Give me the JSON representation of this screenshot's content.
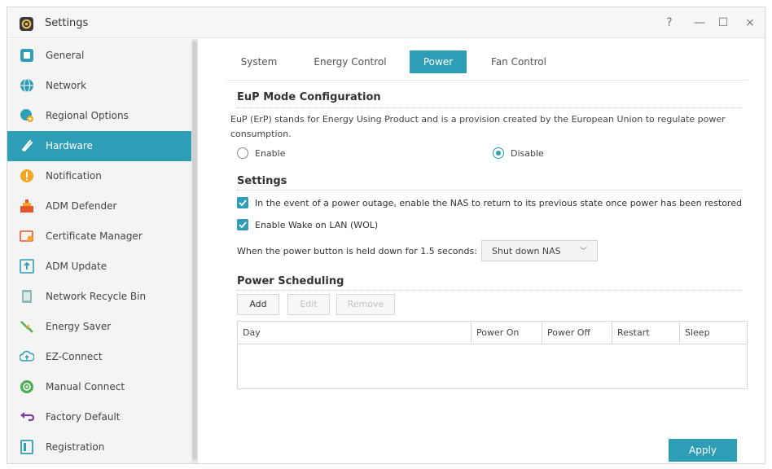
{
  "window": {
    "title": "Settings",
    "help_glyph": "?",
    "minimize_glyph": "—",
    "maximize_glyph": "☐",
    "close_glyph": "×"
  },
  "sidebar": {
    "items": [
      {
        "label": "General",
        "icon": "general-icon",
        "color": "#2e9db6"
      },
      {
        "label": "Network",
        "icon": "globe-icon",
        "color": "#2e9db6"
      },
      {
        "label": "Regional Options",
        "icon": "regional-icon",
        "color": "#2e9db6"
      },
      {
        "label": "Hardware",
        "icon": "hardware-icon",
        "color": "#ffffff",
        "active": true
      },
      {
        "label": "Notification",
        "icon": "notification-icon",
        "color": "#f5a623"
      },
      {
        "label": "ADM Defender",
        "icon": "defender-icon",
        "color": "#e8542c"
      },
      {
        "label": "Certificate Manager",
        "icon": "certificate-icon",
        "color": "#e8542c"
      },
      {
        "label": "ADM Update",
        "icon": "update-icon",
        "color": "#2e9db6"
      },
      {
        "label": "Network Recycle Bin",
        "icon": "recycle-bin-icon",
        "color": "#7aa"
      },
      {
        "label": "Energy Saver",
        "icon": "energy-saver-icon",
        "color": "#4caf50"
      },
      {
        "label": "EZ-Connect",
        "icon": "cloud-icon",
        "color": "#2e9db6"
      },
      {
        "label": "Manual Connect",
        "icon": "manual-connect-icon",
        "color": "#4caf50"
      },
      {
        "label": "Factory Default",
        "icon": "undo-icon",
        "color": "#7b3fa0"
      },
      {
        "label": "Registration",
        "icon": "registration-icon",
        "color": "#2e9db6"
      }
    ]
  },
  "tabs": [
    {
      "label": "System"
    },
    {
      "label": "Energy Control"
    },
    {
      "label": "Power",
      "active": true
    },
    {
      "label": "Fan Control"
    }
  ],
  "eup": {
    "title": "EuP Mode Configuration",
    "description": "EuP (ErP) stands for Energy Using Product and is a provision created by the European Union to regulate power consumption.",
    "enable_label": "Enable",
    "disable_label": "Disable",
    "selected": "Disable"
  },
  "settings": {
    "title": "Settings",
    "restore_label": "In the event of a power outage, enable the NAS to return to its previous state once power has been restored",
    "wol_label": "Enable Wake on LAN (WOL)",
    "power_button_label": "When the power button is held down for 1.5 seconds:",
    "power_button_value": "Shut down NAS",
    "chevron": "﹀"
  },
  "scheduling": {
    "title": "Power Scheduling",
    "add_label": "Add",
    "edit_label": "Edit",
    "remove_label": "Remove",
    "columns": [
      "Day",
      "Power On",
      "Power Off",
      "Restart",
      "Sleep"
    ]
  },
  "footer": {
    "apply_label": "Apply"
  },
  "colors": {
    "accent": "#2e9db6"
  }
}
